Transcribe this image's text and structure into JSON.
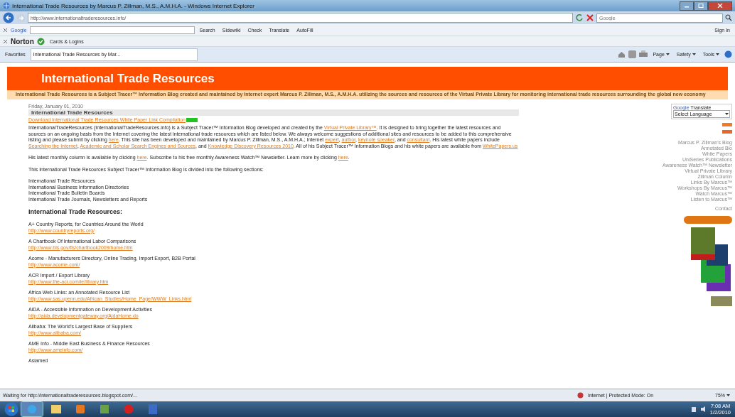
{
  "window": {
    "title": "International Trade Resources by Marcus P. Zillman, M.S., A.M.H.A. - Windows Internet Explorer"
  },
  "address_bar": {
    "url": "http://www.internationaltraderesources.info/",
    "search_placeholder": "Google"
  },
  "google_toolbar": {
    "label": "Google",
    "buttons": [
      "Search",
      "Sidewiki",
      "Check",
      "Translate",
      "AutoFill"
    ],
    "sign_in": "Sign In"
  },
  "norton_toolbar": {
    "label": "Norton",
    "cards": "Cards & Logins"
  },
  "favorites_bar": {
    "favorites": "Favorites",
    "tabs": [
      {
        "label": "International Trade Resources by Mar...",
        "selected": true
      }
    ],
    "commands": [
      "Page",
      "Safety",
      "Tools"
    ]
  },
  "page": {
    "blog_title": "International Trade Resources",
    "tagline": "International Trade Resources is a Subject Tracer™ Information Blog created and maintained by Internet expert Marcus P. Zillman, M.S., A.M.H.A. utilizing the sources and resources of the Virtual Private Library for monitoring international trade resources surrounding the global new economy",
    "post_date": "Friday, January 01, 2010",
    "post_title": "International Trade Resources",
    "download_link": "Download International Trade Resources White Paper Link Compilation",
    "intro": [
      {
        "kind": "text",
        "text": "InternationalTradeResources (InternationalTradeResources.info) is a Subject Tracer™ Information Blog developed and created by the "
      },
      {
        "kind": "link",
        "text": "Virtual Private Library™"
      },
      {
        "kind": "text",
        "text": ". It is designed to bring together the latest resources and sources on an ongoing basis from the Internet covering the latest international trade resources which are listed below. We always welcome suggestions of additional sites and resources to be added to this comprehensive listing and please submit by clicking "
      },
      {
        "kind": "link",
        "text": "here"
      },
      {
        "kind": "text",
        "text": ". This site has been developed and maintained by Marcus P. Zillman, M.S., A.M.H.A.; Internet "
      },
      {
        "kind": "link",
        "text": "expert"
      },
      {
        "kind": "text",
        "text": ", "
      },
      {
        "kind": "link",
        "text": "author"
      },
      {
        "kind": "text",
        "text": ", "
      },
      {
        "kind": "link",
        "text": "keynote speaker"
      },
      {
        "kind": "text",
        "text": ", and "
      },
      {
        "kind": "link",
        "text": "consultant"
      },
      {
        "kind": "text",
        "text": ". His latest white papers include "
      },
      {
        "kind": "link",
        "text": "Searching the Internet"
      },
      {
        "kind": "text",
        "text": ", "
      },
      {
        "kind": "link",
        "text": "Academic and Scholar Search Engines and Sources"
      },
      {
        "kind": "text",
        "text": ", and "
      },
      {
        "kind": "link",
        "text": "Knowledge Discovery Resources 2010"
      },
      {
        "kind": "text",
        "text": ". All of his Subject Tracer™ Information Blogs and his white papers are available from "
      },
      {
        "kind": "link",
        "text": "WhitePapers.us"
      }
    ],
    "monthly": [
      {
        "kind": "text",
        "text": "His latest monthly column is available by clicking "
      },
      {
        "kind": "link",
        "text": "here"
      },
      {
        "kind": "text",
        "text": ". Subscribe to his free monthly Awareness Watch™ Newsletter. Learn more by clicking "
      },
      {
        "kind": "link",
        "text": "here"
      },
      {
        "kind": "text",
        "text": "."
      }
    ],
    "sections_intro": "This International Trade Resources Subject Tracer™ Information Blog is divided into the following sections:",
    "sections": [
      "International Trade Resources",
      "International Business Information Directories",
      "International Trade Bulletin Boards",
      "International Trade Journals, Newsletters and Reports"
    ],
    "resources_heading": "International Trade Resources:",
    "resources": [
      {
        "name": "A+ Country Reports, for Countries Around the World",
        "url": "http://www.countryreports.org/"
      },
      {
        "name": "A Chartbook Of International Labor Comparisons",
        "url": "http://www.bls.gov/fls/chartbook2009/home.htm"
      },
      {
        "name": "Acome - Manufacturers Directory, Online Trading, Import Export, B2B Portal",
        "url": "http://www.acome.com/"
      },
      {
        "name": "ACR Import / Export Library",
        "url": "http://www.the-acr.com/ie/library.htm"
      },
      {
        "name": "Africa Web Links: an Annotated Resource List",
        "url": "http://www.sas.upenn.edu/African_Studies/Home_Page/WWW_Links.html"
      },
      {
        "name": "AiDA - Accessible Information on Development Activities",
        "url": "http://aida.developmentgateway.org/AidaHome.do"
      },
      {
        "name": "Alibaba: The World's Largest Base of Suppliers",
        "url": "http://www.alibaba.com/"
      },
      {
        "name": "AME Info - Middle East Business & Finance Resources",
        "url": "http://www.ameinfo.com/"
      },
      {
        "name": "Asiamed"
      }
    ]
  },
  "sidebar": {
    "translate_brand": "Google",
    "translate_label": "Translate",
    "select": "Select Language",
    "links": [
      "Marcus P. Zillman's Blog",
      "Annotated Bio",
      "White Papers",
      "UniSeries Publications",
      "Awareness Watch™ Newsletter",
      "Virtual Private Library",
      "Zillman Column",
      "Links By Marcus™",
      "Workshops By Marcus™",
      "Watch Marcus™",
      "Listen to Marcus™",
      "Contact"
    ]
  },
  "status_bar": {
    "text": "Waiting for http://internationaltraderesources.blogspot.com/...",
    "zone": "Internet | Protected Mode: On",
    "zoom": "75%"
  },
  "taskbar": {
    "time": "7:08 AM",
    "date": "1/2/2010"
  }
}
